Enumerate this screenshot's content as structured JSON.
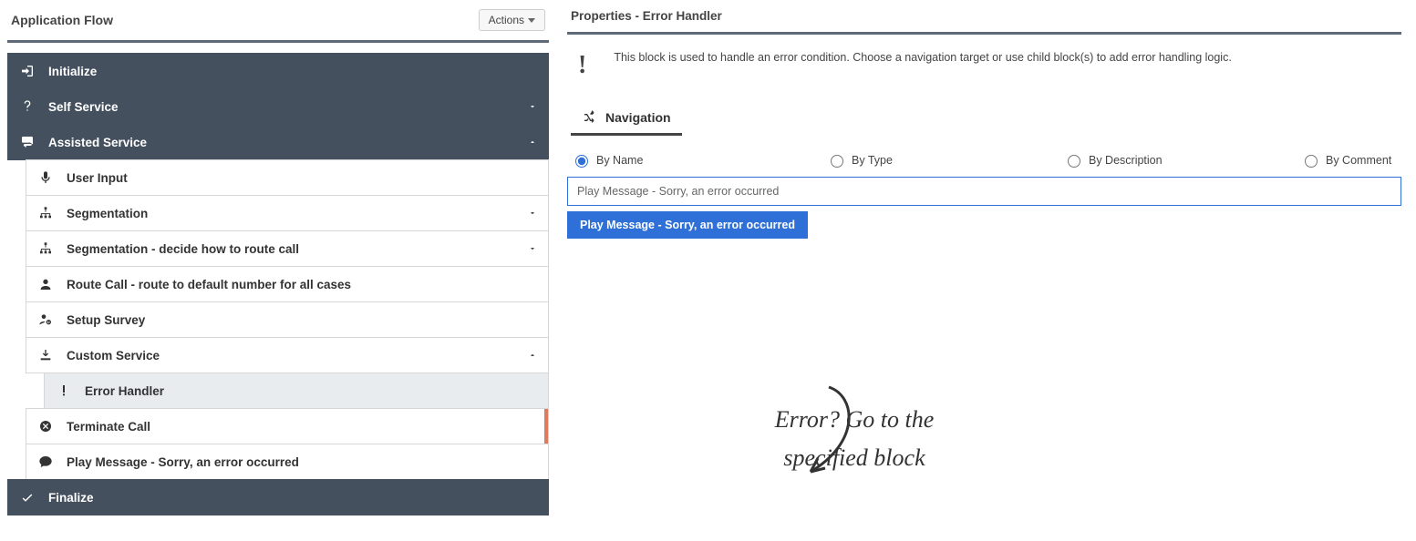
{
  "left": {
    "title": "Application Flow",
    "actions_label": "Actions",
    "items": {
      "initialize": "Initialize",
      "self_service": "Self Service",
      "assisted_service": "Assisted Service",
      "user_input": "User Input",
      "segmentation": "Segmentation",
      "segmentation_route": "Segmentation - decide how to route call",
      "route_call": "Route Call - route to default number for all cases",
      "setup_survey": "Setup Survey",
      "custom_service": "Custom Service",
      "error_handler": "Error Handler",
      "terminate_call": "Terminate Call",
      "play_message": "Play Message - Sorry, an error occurred",
      "finalize": "Finalize"
    }
  },
  "right": {
    "title": "Properties - Error Handler",
    "desc": "This block is used to handle an error condition. Choose a navigation target or use child block(s) to add error handling logic.",
    "tab": "Navigation",
    "radios": {
      "by_name": "By Name",
      "by_type": "By Type",
      "by_description": "By Description",
      "by_comment": "By Comment"
    },
    "search_value": "Play Message - Sorry, an error occurred",
    "dropdown_item": "Play Message - Sorry, an error occurred"
  },
  "annotation": {
    "line1": "Error? Go to the",
    "line2": "specified block"
  }
}
